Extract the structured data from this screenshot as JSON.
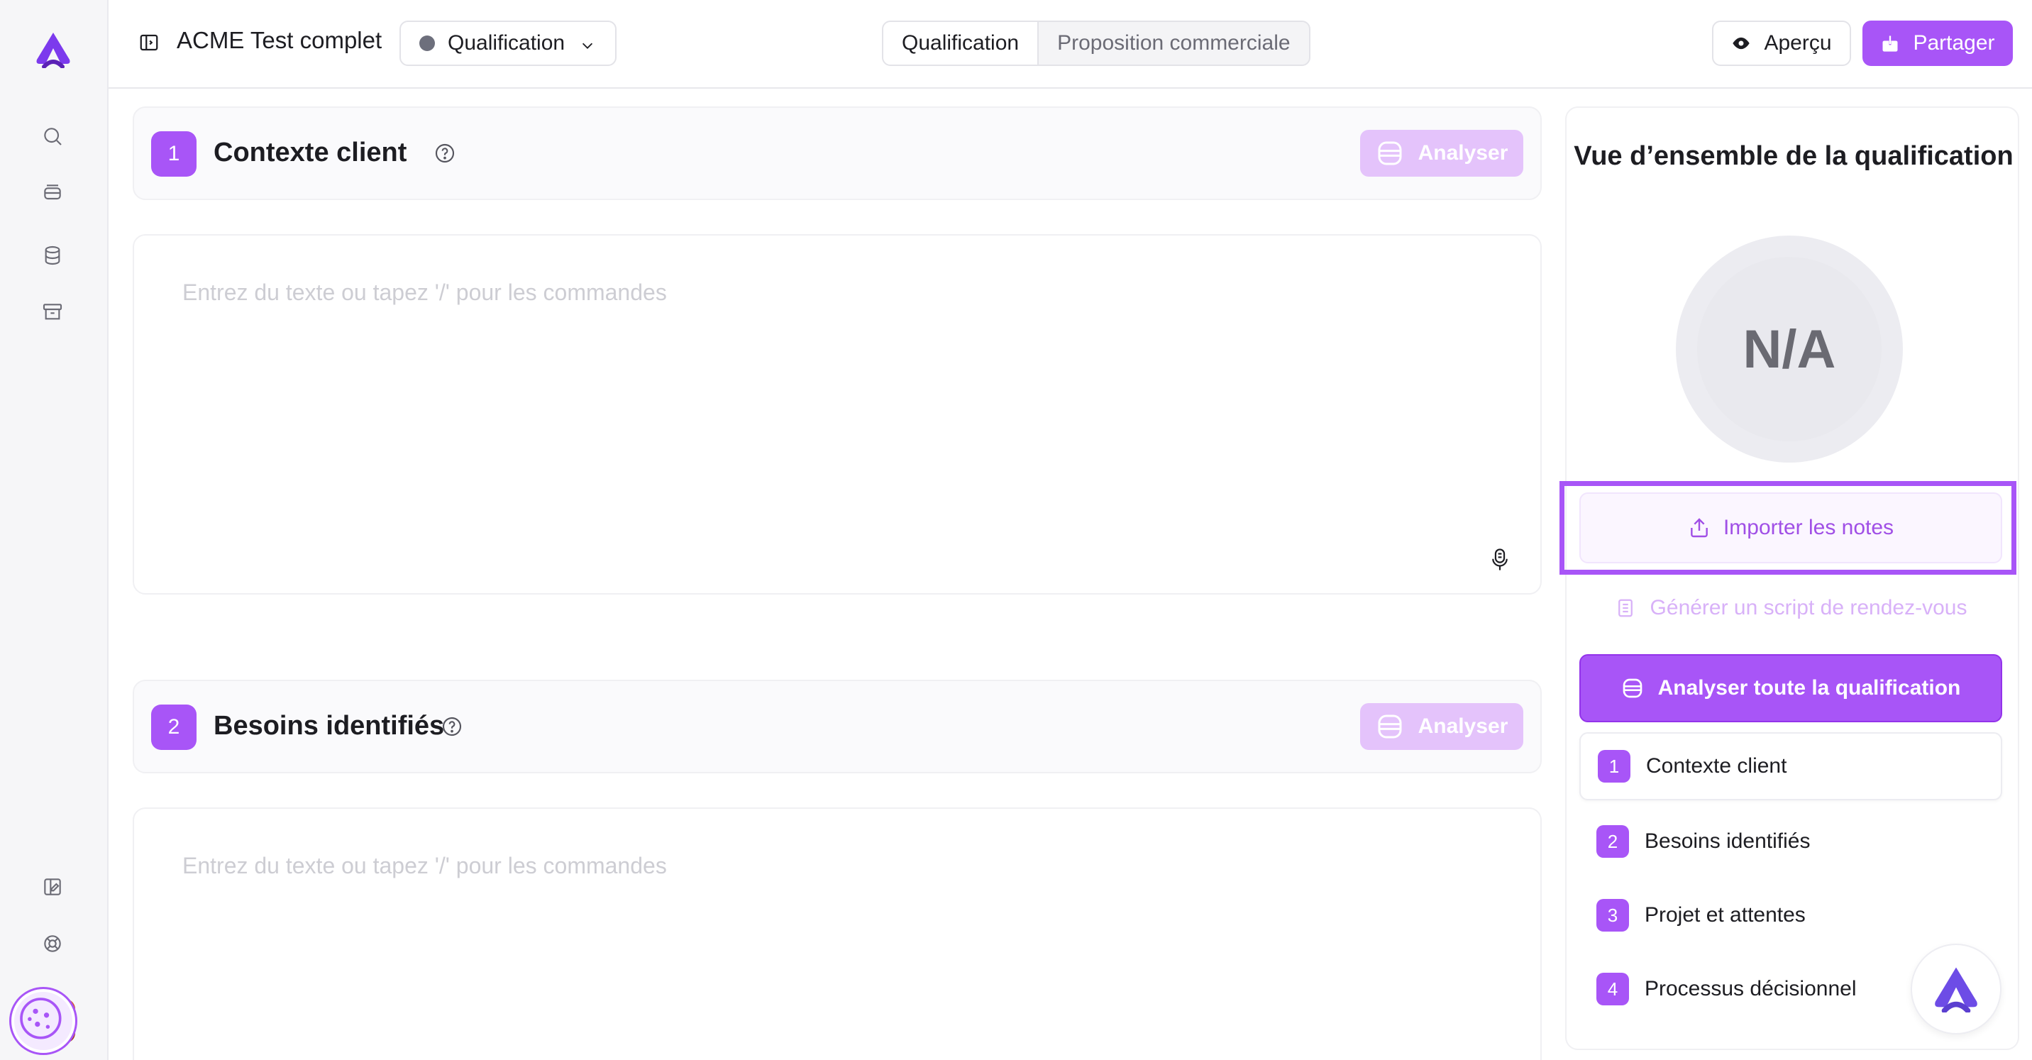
{
  "rail": {
    "icons": [
      "search-icon",
      "layers-icon",
      "database-icon",
      "archive-icon",
      "edit-settings-icon",
      "help-lifebuoy-icon"
    ]
  },
  "header": {
    "doc_title": "ACME Test complet",
    "stage": "Qualification",
    "tabs": [
      "Qualification",
      "Proposition commerciale"
    ],
    "preview_label": "Aperçu",
    "share_label": "Partager"
  },
  "sections": [
    {
      "number": "1",
      "title": "Contexte client",
      "analyze_label": "Analyser",
      "placeholder": "Entrez du texte ou tapez '/' pour les commandes"
    },
    {
      "number": "2",
      "title": "Besoins identifiés",
      "analyze_label": "Analyser",
      "placeholder": "Entrez du texte ou tapez '/' pour les commandes"
    }
  ],
  "panel": {
    "title": "Vue d’ensemble de la qualification",
    "score": "N/A",
    "import_label": "Importer les notes",
    "script_label": "Générer un script de rendez-vous",
    "analyze_all_label": "Analyser toute la qualification",
    "toc": [
      {
        "number": "1",
        "label": "Contexte client"
      },
      {
        "number": "2",
        "label": "Besoins identifiés"
      },
      {
        "number": "3",
        "label": "Projet et attentes"
      },
      {
        "number": "4",
        "label": "Processus décisionnel"
      }
    ]
  },
  "colors": {
    "accent": "#a855f7",
    "accent_disabled": "#e4c3fb",
    "stage_dot": "#6d6f7c"
  }
}
